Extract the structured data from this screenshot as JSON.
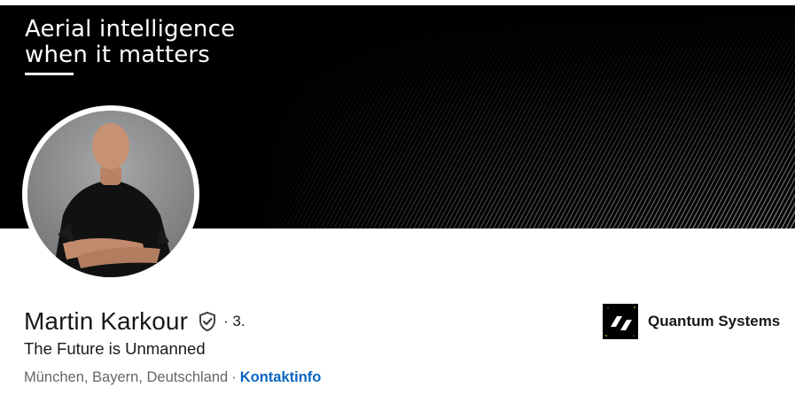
{
  "banner": {
    "headline_line1": "Aerial intelligence",
    "headline_line2": "when it matters"
  },
  "profile": {
    "name": "Martin Karkour",
    "degree": "· 3.",
    "headline": "The Future is Unmanned",
    "location": "München, Bayern, Deutschland",
    "separator": "·",
    "contact_link": "Kontaktinfo"
  },
  "company": {
    "name": "Quantum Systems",
    "logo_icon": "quantum-systems-logo"
  },
  "colors": {
    "link": "#0a66c2",
    "text_primary": "#191919",
    "text_secondary": "#666666",
    "banner_bg": "#000000"
  }
}
